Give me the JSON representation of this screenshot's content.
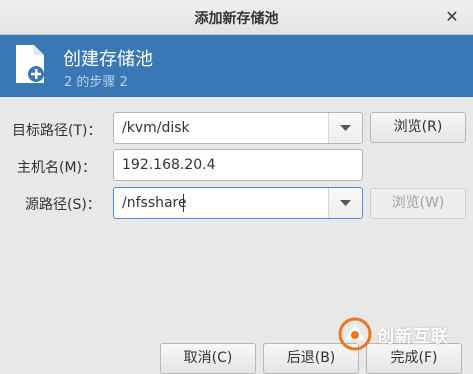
{
  "window": {
    "title": "添加新存储池",
    "close_glyph": "✕"
  },
  "banner": {
    "icon": "new-document-icon",
    "heading": "创建存储池",
    "step": "2 的步骤 2",
    "color": "#3a78b5"
  },
  "form": {
    "target_path": {
      "label": "目标路径(T)：",
      "value": "/kvm/disk",
      "browse": "浏览(R)"
    },
    "hostname": {
      "label": "主机名(M)：",
      "value": "192.168.20.4"
    },
    "source_path": {
      "label": "源路径(S)：",
      "value": "/nfsshare",
      "browse": "浏览(W)"
    }
  },
  "footer": {
    "cancel": "取消(C)",
    "back": "后退(B)",
    "finish": "完成(F)"
  },
  "watermark": {
    "logo": "chuangxin-hulian-logo",
    "text": "创新互联"
  }
}
